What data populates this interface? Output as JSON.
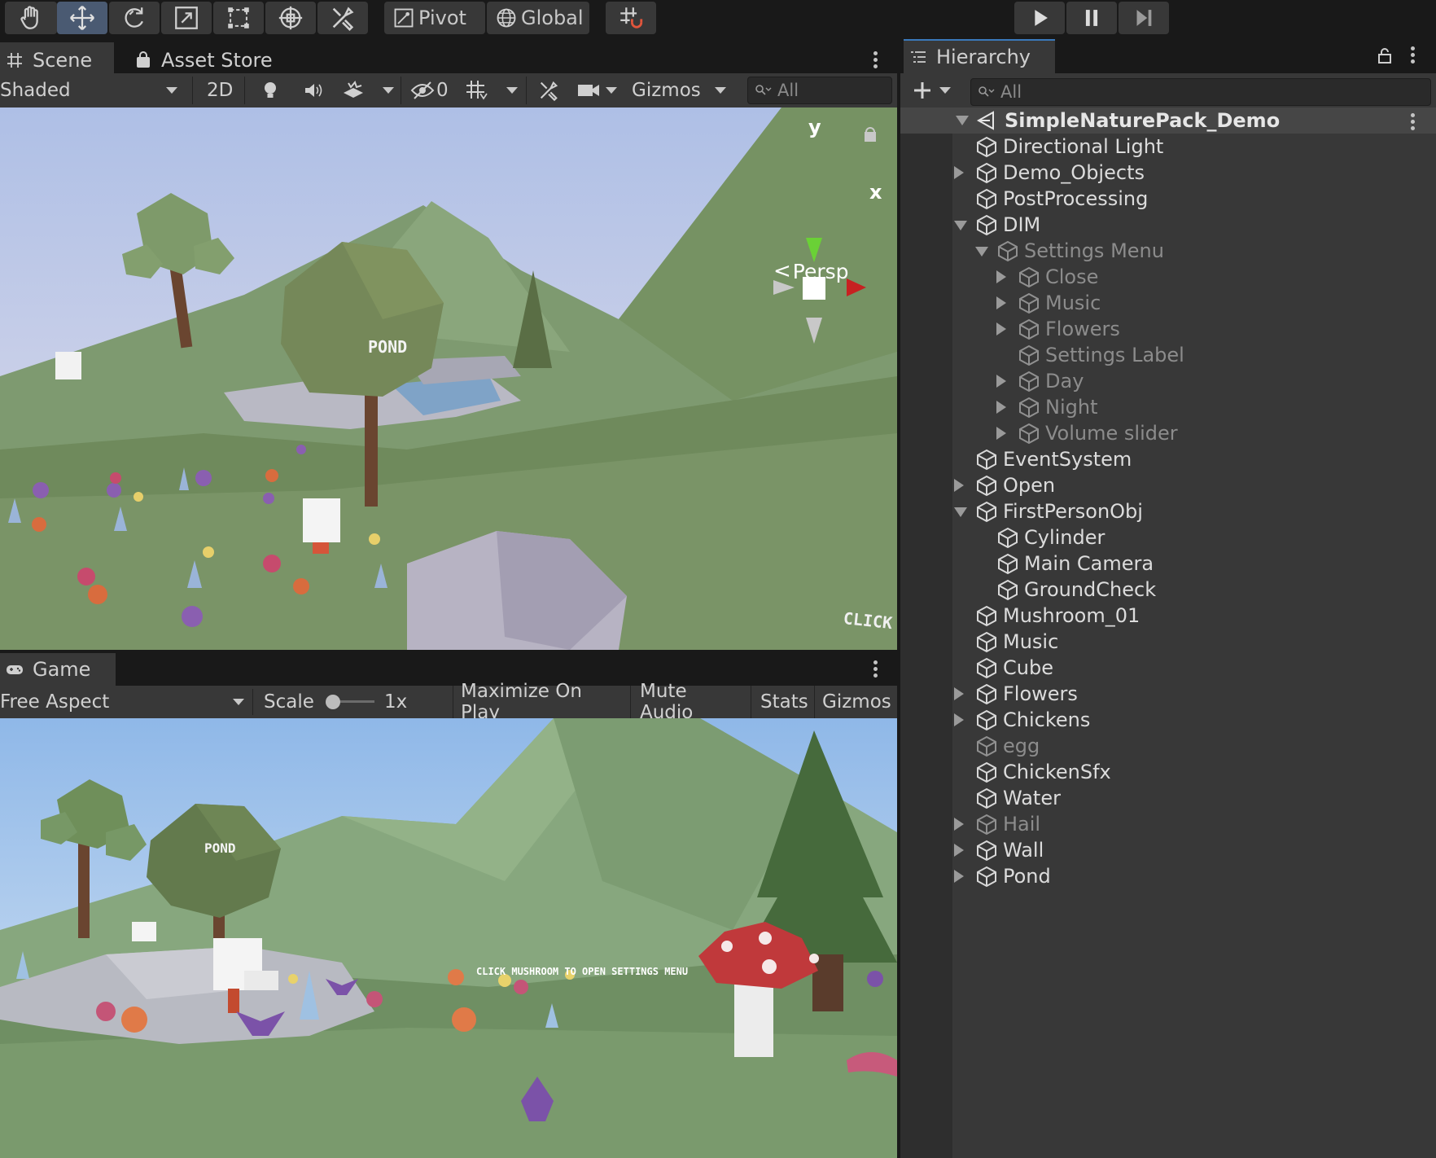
{
  "toolbar": {
    "tools": [
      {
        "icon": "hand-icon"
      },
      {
        "icon": "move-icon"
      },
      {
        "icon": "rotate-icon"
      },
      {
        "icon": "scale-icon"
      },
      {
        "icon": "rect-icon"
      },
      {
        "icon": "transform-icon"
      },
      {
        "icon": "custom-tool-icon"
      }
    ],
    "pivot_label": "Pivot",
    "global_label": "Global",
    "snap_icon": "grid-snap-icon",
    "play_icon": "play-icon",
    "pause_icon": "pause-icon",
    "step_icon": "step-icon"
  },
  "scene_panel": {
    "tabs": [
      "Scene",
      "Asset Store"
    ],
    "shading_mode": "Shaded",
    "mode_2d": "2D",
    "effects_count": "0",
    "gizmos_label": "Gizmos",
    "search_placeholder": "All",
    "gizmo_axes": {
      "y": "y",
      "x": "x"
    },
    "projection_label": "Persp",
    "sign_text": "POND",
    "corner_text": "CLICK"
  },
  "game_panel": {
    "tab": "Game",
    "aspect": "Free Aspect",
    "scale_label": "Scale",
    "scale_value": "1x",
    "maximize_on_play": "Maximize On Play",
    "mute_audio": "Mute Audio",
    "stats": "Stats",
    "gizmos": "Gizmos",
    "sign_text": "POND",
    "hint_text": "CLICK MUSHROOM TO OPEN SETTINGS MENU"
  },
  "hierarchy": {
    "tab": "Hierarchy",
    "search_placeholder": "All",
    "root": "SimpleNaturePack_Demo",
    "items": [
      {
        "name": "Directional Light",
        "depth": 0,
        "expand": "none",
        "active": true
      },
      {
        "name": "Demo_Objects",
        "depth": 0,
        "expand": "collapsed",
        "active": true
      },
      {
        "name": "PostProcessing",
        "depth": 0,
        "expand": "none",
        "active": true
      },
      {
        "name": "DIM",
        "depth": 0,
        "expand": "expanded",
        "active": true
      },
      {
        "name": "Settings Menu",
        "depth": 1,
        "expand": "expanded",
        "active": false
      },
      {
        "name": "Close",
        "depth": 2,
        "expand": "collapsed",
        "active": false
      },
      {
        "name": "Music",
        "depth": 2,
        "expand": "collapsed",
        "active": false
      },
      {
        "name": "Flowers",
        "depth": 2,
        "expand": "collapsed",
        "active": false
      },
      {
        "name": "Settings Label",
        "depth": 2,
        "expand": "none",
        "active": false
      },
      {
        "name": "Day",
        "depth": 2,
        "expand": "collapsed",
        "active": false
      },
      {
        "name": "Night",
        "depth": 2,
        "expand": "collapsed",
        "active": false
      },
      {
        "name": "Volume slider",
        "depth": 2,
        "expand": "collapsed",
        "active": false
      },
      {
        "name": "EventSystem",
        "depth": 0,
        "expand": "none",
        "active": true
      },
      {
        "name": "Open",
        "depth": 0,
        "expand": "collapsed",
        "active": true
      },
      {
        "name": "FirstPersonObj",
        "depth": 0,
        "expand": "expanded",
        "active": true
      },
      {
        "name": "Cylinder",
        "depth": 1,
        "expand": "none",
        "active": true
      },
      {
        "name": "Main Camera",
        "depth": 1,
        "expand": "none",
        "active": true
      },
      {
        "name": "GroundCheck",
        "depth": 1,
        "expand": "none",
        "active": true
      },
      {
        "name": "Mushroom_01",
        "depth": 0,
        "expand": "none",
        "active": true
      },
      {
        "name": "Music",
        "depth": 0,
        "expand": "none",
        "active": true
      },
      {
        "name": "Cube",
        "depth": 0,
        "expand": "none",
        "active": true
      },
      {
        "name": "Flowers",
        "depth": 0,
        "expand": "collapsed",
        "active": true
      },
      {
        "name": "Chickens",
        "depth": 0,
        "expand": "collapsed",
        "active": true
      },
      {
        "name": "egg",
        "depth": 0,
        "expand": "none",
        "active": false
      },
      {
        "name": "ChickenSfx",
        "depth": 0,
        "expand": "none",
        "active": true
      },
      {
        "name": "Water",
        "depth": 0,
        "expand": "none",
        "active": true
      },
      {
        "name": "Hail",
        "depth": 0,
        "expand": "collapsed",
        "active": false
      },
      {
        "name": "Wall",
        "depth": 0,
        "expand": "collapsed",
        "active": true
      },
      {
        "name": "Pond",
        "depth": 0,
        "expand": "collapsed",
        "active": true
      }
    ]
  },
  "colors": {
    "editor_bg": "#383838",
    "toolbar_bg": "#191919",
    "active_tool": "#4a5a72",
    "hierarchy_header": "#464646",
    "inactive_text": "#8c8c8c"
  }
}
